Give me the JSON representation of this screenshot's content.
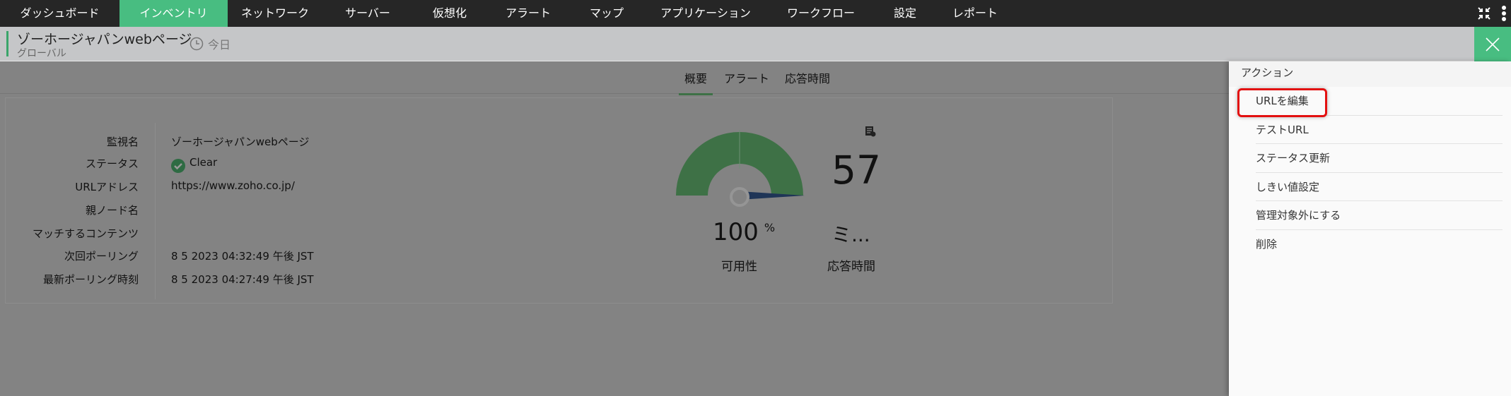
{
  "nav": {
    "items": [
      "ダッシュボード",
      "インベントリ",
      "ネットワーク",
      "サーバー",
      "仮想化",
      "アラート",
      "マップ",
      "アプリケーション",
      "ワークフロー",
      "設定",
      "レポート"
    ],
    "active": 1
  },
  "header": {
    "title": "ゾーホージャパンwebページ",
    "subtitle": "グローバル",
    "period": "今日"
  },
  "tabs": [
    "概要",
    "アラート",
    "応答時間"
  ],
  "details": [
    {
      "label": "監視名",
      "value": "ゾーホージャパンwebページ"
    },
    {
      "label": "ステータス",
      "value": "Clear"
    },
    {
      "label": "URLアドレス",
      "value": "https://www.zoho.co.jp/"
    },
    {
      "label": "親ノード名",
      "value": ""
    },
    {
      "label": "マッチするコンテンツ",
      "value": ""
    },
    {
      "label": "次回ポーリング",
      "value": "8 5 2023 04:32:49 午後 JST"
    },
    {
      "label": "最新ポーリング時刻",
      "value": "8 5 2023 04:27:49 午後 JST"
    }
  ],
  "availability": {
    "value": "100",
    "unit": "%",
    "label": "可用性",
    "percent": 100
  },
  "response": {
    "value": "57",
    "unit": "ミ...",
    "label": "応答時間"
  },
  "actions": {
    "title": "アクション",
    "items": [
      "URLを編集",
      "テストURL",
      "ステータス更新",
      "しきい値設定",
      "管理対象外にする",
      "削除"
    ]
  },
  "colors": {
    "accent": "#48bd81",
    "gauge": "#3e7146",
    "needle": "#1f3557",
    "highlight": "#e31010"
  }
}
